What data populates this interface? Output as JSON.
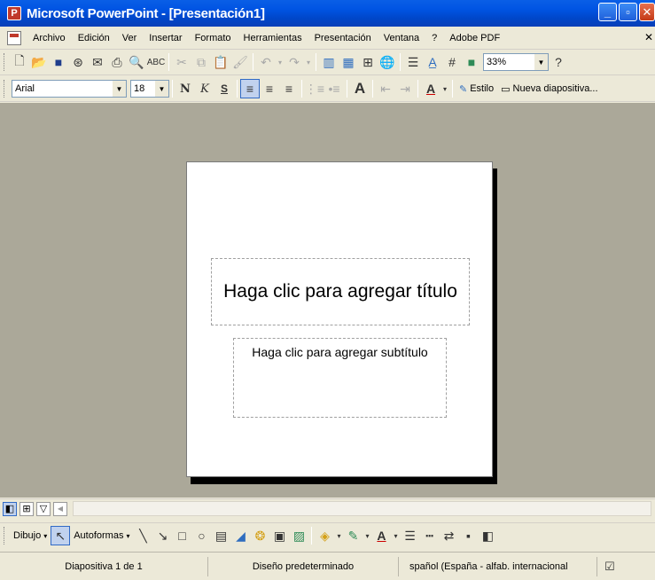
{
  "window": {
    "title": "Microsoft PowerPoint - [Presentación1]"
  },
  "menu": {
    "items": [
      "Archivo",
      "Edición",
      "Ver",
      "Insertar",
      "Formato",
      "Herramientas",
      "Presentación",
      "Ventana",
      "?",
      "Adobe PDF"
    ]
  },
  "toolbar_standard": {
    "zoom_value": "33%"
  },
  "toolbar_format": {
    "font_name": "Arial",
    "font_size": "18",
    "bold_label": "N",
    "italic_label": "K",
    "shadow_label": "S",
    "style_label": "Estilo",
    "new_slide_label": "Nueva diapositiva..."
  },
  "slide": {
    "title_placeholder": "Haga clic para agregar título",
    "subtitle_placeholder": "Haga clic para agregar subtítulo"
  },
  "drawing_toolbar": {
    "draw_label": "Dibujo",
    "autoshapes_label": "Autoformas"
  },
  "status": {
    "slide_info": "Diapositiva 1 de 1",
    "design": "Diseño predeterminado",
    "language": "spañol (España - alfab. internacional"
  },
  "colors": {
    "titlebar": "#0054E3",
    "chrome": "#ECE9D8",
    "workspace": "#ABA899"
  }
}
